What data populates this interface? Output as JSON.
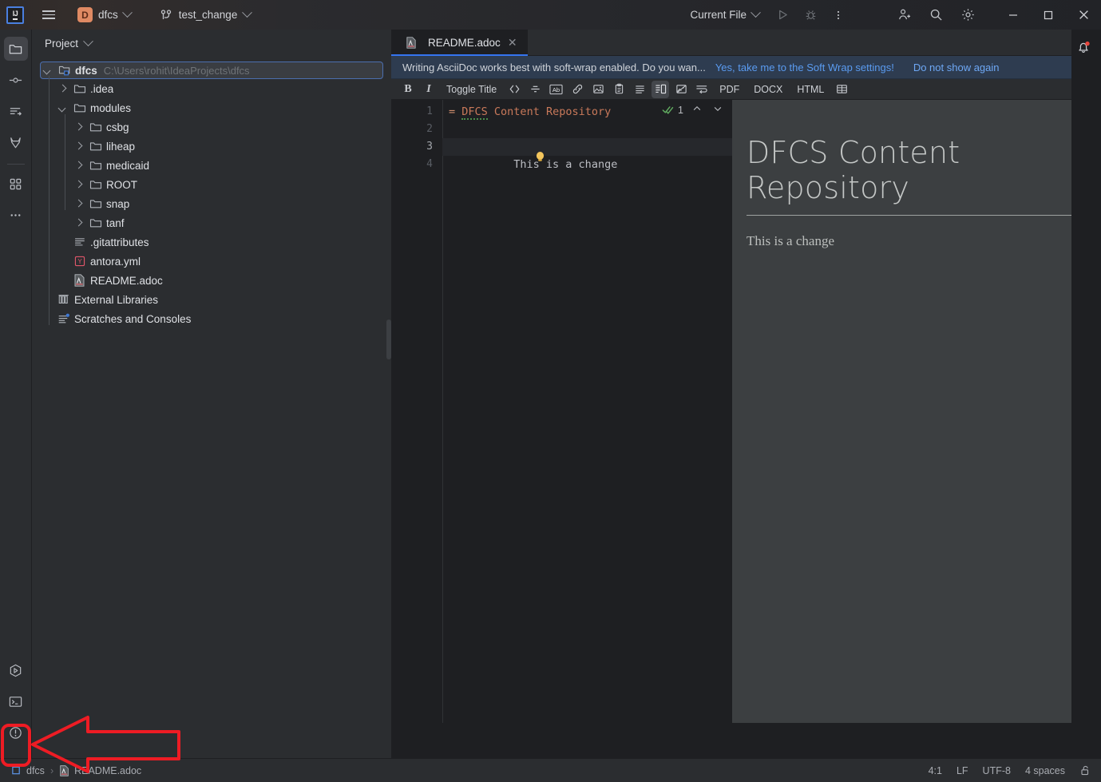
{
  "titlebar": {
    "logo": "ij-logo",
    "menu_icon": "hamburger-menu-icon",
    "project_badge": "D",
    "project_name": "dfcs",
    "branch_icon": "git-branch-icon",
    "branch_name": "test_change",
    "run_config": "Current File",
    "run_icon": "run-icon",
    "debug_icon": "debug-icon",
    "more_icon": "more-vertical-icon",
    "account_icon": "add-user-icon",
    "search_icon": "search-icon",
    "settings_icon": "gear-icon",
    "minimize": "minimize-icon",
    "maximize": "maximize-icon",
    "close": "close-icon"
  },
  "stripe": {
    "top_items": [
      {
        "name": "project-tool-button",
        "icon": "folder-icon",
        "active": true
      },
      {
        "name": "commit-tool-button",
        "icon": "commit-icon",
        "active": false
      },
      {
        "name": "pull-requests-tool-button",
        "icon": "pull-request-icon",
        "active": false
      },
      {
        "name": "gitlab-tool-button",
        "icon": "gitlab-icon",
        "active": false
      },
      {
        "name": "plugins-tool-button",
        "icon": "plugins-grid-icon",
        "active": false
      },
      {
        "name": "more-tool-windows-button",
        "icon": "more-horizontal-icon",
        "active": false
      }
    ],
    "bottom_items": [
      {
        "name": "run-tool-button",
        "icon": "run-hex-icon",
        "active": false
      },
      {
        "name": "terminal-tool-button",
        "icon": "terminal-icon",
        "active": false
      },
      {
        "name": "problems-tool-button",
        "icon": "warning-circle-icon",
        "active": false
      },
      {
        "name": "git-tool-button",
        "icon": "git-branch-icon",
        "active": false,
        "highlighted": true
      }
    ]
  },
  "project": {
    "header_title": "Project",
    "header_chevron": "chevron-down-icon",
    "tree": [
      {
        "depth": 0,
        "arrow": "open",
        "icon": "project-folder-icon",
        "label": "dfcs",
        "bold": true,
        "path": "C:\\Users\\rohit\\IdeaProjects\\dfcs",
        "selected": true
      },
      {
        "depth": 1,
        "arrow": "closed",
        "icon": "folder-icon",
        "label": ".idea"
      },
      {
        "depth": 1,
        "arrow": "open",
        "icon": "folder-icon",
        "label": "modules"
      },
      {
        "depth": 2,
        "arrow": "closed",
        "icon": "folder-icon",
        "label": "csbg"
      },
      {
        "depth": 2,
        "arrow": "closed",
        "icon": "folder-icon",
        "label": "liheap"
      },
      {
        "depth": 2,
        "arrow": "closed",
        "icon": "folder-icon",
        "label": "medicaid"
      },
      {
        "depth": 2,
        "arrow": "closed",
        "icon": "folder-icon",
        "label": "ROOT"
      },
      {
        "depth": 2,
        "arrow": "closed",
        "icon": "folder-icon",
        "label": "snap"
      },
      {
        "depth": 2,
        "arrow": "closed",
        "icon": "folder-icon",
        "label": "tanf"
      },
      {
        "depth": 1,
        "arrow": "none",
        "icon": "text-file-icon",
        "label": ".gitattributes"
      },
      {
        "depth": 1,
        "arrow": "none",
        "icon": "yaml-file-icon",
        "label": "antora.yml"
      },
      {
        "depth": 1,
        "arrow": "none",
        "icon": "asciidoc-file-icon",
        "label": "README.adoc"
      },
      {
        "depth": 0,
        "arrow": "none",
        "icon": "libraries-icon",
        "label": "External Libraries"
      },
      {
        "depth": 0,
        "arrow": "none",
        "icon": "scratches-icon",
        "label": "Scratches and Consoles"
      }
    ]
  },
  "editor": {
    "tab": {
      "label": "README.adoc",
      "icon": "asciidoc-file-icon",
      "close_icon": "close-icon"
    },
    "tab_options_icon": "more-vertical-icon",
    "notifications_icon": "notification-bell-icon",
    "notification": {
      "message": "Writing AsciiDoc works best with soft-wrap enabled. Do you wan...",
      "action": "Yes, take me to the Soft Wrap settings!",
      "dismiss": "Do not show again"
    },
    "toolbar": [
      {
        "name": "bold-button",
        "kind": "glyph",
        "label": "B",
        "icon": "bold-icon"
      },
      {
        "name": "italic-button",
        "kind": "glyph",
        "label": "I",
        "icon": "italic-icon"
      },
      {
        "name": "toggle-title-button",
        "kind": "text",
        "label": "Toggle Title",
        "icon": "toggle-title-icon"
      },
      {
        "name": "code-button",
        "kind": "icon",
        "icon": "code-brackets-icon"
      },
      {
        "name": "strikethrough-button",
        "kind": "icon",
        "icon": "strikethrough-icon"
      },
      {
        "name": "attribute-button",
        "kind": "icon",
        "icon": "ab-attribute-icon"
      },
      {
        "name": "link-button",
        "kind": "icon",
        "icon": "link-icon"
      },
      {
        "name": "image-button",
        "kind": "icon",
        "icon": "image-icon"
      },
      {
        "name": "clipboard-button",
        "kind": "icon",
        "icon": "clipboard-icon"
      },
      {
        "name": "list-button",
        "kind": "icon",
        "icon": "list-icon"
      },
      {
        "name": "split-view-button",
        "kind": "icon",
        "icon": "split-editor-icon",
        "active": true
      },
      {
        "name": "preview-only-button",
        "kind": "icon",
        "icon": "preview-image-icon"
      },
      {
        "name": "soft-wrap-button",
        "kind": "icon",
        "icon": "soft-wrap-icon"
      },
      {
        "name": "export-pdf-button",
        "kind": "text",
        "label": "PDF",
        "icon": "pdf-icon"
      },
      {
        "name": "export-docx-button",
        "kind": "text",
        "label": "DOCX",
        "icon": "docx-icon"
      },
      {
        "name": "export-html-button",
        "kind": "text",
        "label": "HTML",
        "icon": "html-icon"
      },
      {
        "name": "table-button",
        "kind": "icon",
        "icon": "table-icon"
      }
    ],
    "gutter_lines": [
      "1",
      "2",
      "3",
      "4"
    ],
    "current_line": 3,
    "code": {
      "line1_marker": "=",
      "line1_word": "DFCS",
      "line1_rest": " Content Repository",
      "line3": "This is a change"
    },
    "inspection": {
      "count": "1",
      "icon": "inspection-check-icon",
      "up": "chevron-up-icon",
      "down": "chevron-down-icon"
    },
    "intention_bulb": "intention-bulb-icon",
    "preview": {
      "title": "DFCS Content Repository",
      "body": "This is a change"
    }
  },
  "statusbar": {
    "breadcrumb": [
      {
        "icon": "module-icon",
        "label": "dfcs"
      },
      {
        "icon": "asciidoc-file-icon",
        "label": "README.adoc"
      }
    ],
    "separator": "›",
    "caret_position": "4:1",
    "line_separator": "LF",
    "encoding": "UTF-8",
    "indent": "4 spaces",
    "lock_icon": "unlocked-icon"
  },
  "annotation": {
    "color": "#ee1c24",
    "arrow": "left-pointing-arrow",
    "highlight_box": "git-tool-button-highlight"
  }
}
